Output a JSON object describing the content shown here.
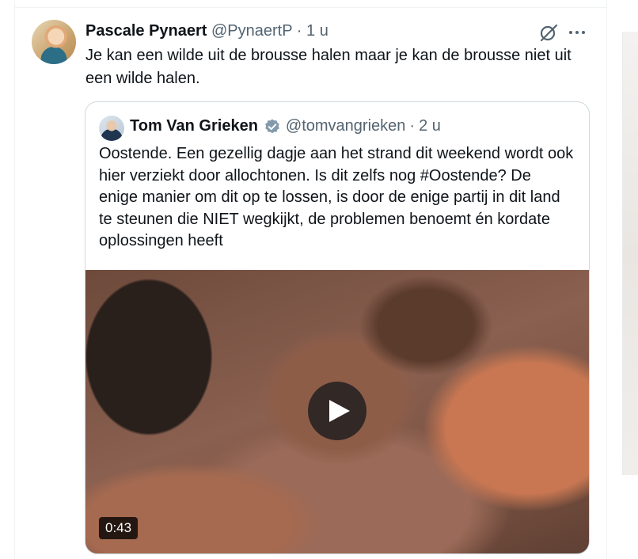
{
  "post": {
    "author_name": "Pascale Pynaert",
    "author_handle": "@PynaertP",
    "separator": "·",
    "time": "1 u",
    "text": "Je kan een wilde uit de brousse halen maar je kan de brousse niet uit een wilde halen."
  },
  "quoted": {
    "author_name": "Tom Van Grieken",
    "author_handle": "@tomvangrieken",
    "separator": "·",
    "time": "2 u",
    "text": "Oostende. Een gezellig dagje aan het strand dit weekend wordt ook hier verziekt door allochtonen. Is dit zelfs nog #Oostende? De enige manier om dit op te lossen, is door de enige partij in dit land te steunen die NIET wegkijkt, de problemen benoemt én kordate oplossingen heeft",
    "video": {
      "duration": "0:43"
    }
  },
  "icons": {
    "grok": "grok-icon",
    "more": "more-icon",
    "verified": "verified-badge-icon",
    "play": "play-icon"
  },
  "colors": {
    "text": "#0f1419",
    "secondary": "#536471",
    "border": "#cfd9de",
    "verified": "#829aab"
  }
}
